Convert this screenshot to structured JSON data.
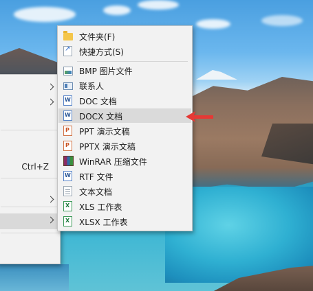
{
  "parent_menu": {
    "undo_shortcut": "Ctrl+Z"
  },
  "new_submenu": {
    "items": [
      {
        "label": "文件夹(F)",
        "icon": "folder-icon"
      },
      {
        "label": "快捷方式(S)",
        "icon": "shortcut-icon"
      },
      {
        "label": "BMP 图片文件",
        "icon": "bmp-image-icon"
      },
      {
        "label": "联系人",
        "icon": "contact-icon"
      },
      {
        "label": "DOC 文档",
        "icon": "doc-document-icon"
      },
      {
        "label": "DOCX 文档",
        "icon": "word-docx-icon"
      },
      {
        "label": "PPT 演示文稿",
        "icon": "ppt-presentation-icon"
      },
      {
        "label": "PPTX 演示文稿",
        "icon": "pptx-presentation-icon"
      },
      {
        "label": "WinRAR 压缩文件",
        "icon": "winrar-archive-icon"
      },
      {
        "label": "RTF 文件",
        "icon": "rtf-document-icon"
      },
      {
        "label": "文本文档",
        "icon": "text-document-icon"
      },
      {
        "label": "XLS 工作表",
        "icon": "xls-spreadsheet-icon"
      },
      {
        "label": "XLSX 工作表",
        "icon": "xlsx-spreadsheet-icon"
      }
    ],
    "highlighted_item": "DOCX 文档"
  },
  "colors": {
    "menu_background": "#f2f2f2",
    "hover_background": "#dadada",
    "pointer_arrow": "#e53935"
  }
}
